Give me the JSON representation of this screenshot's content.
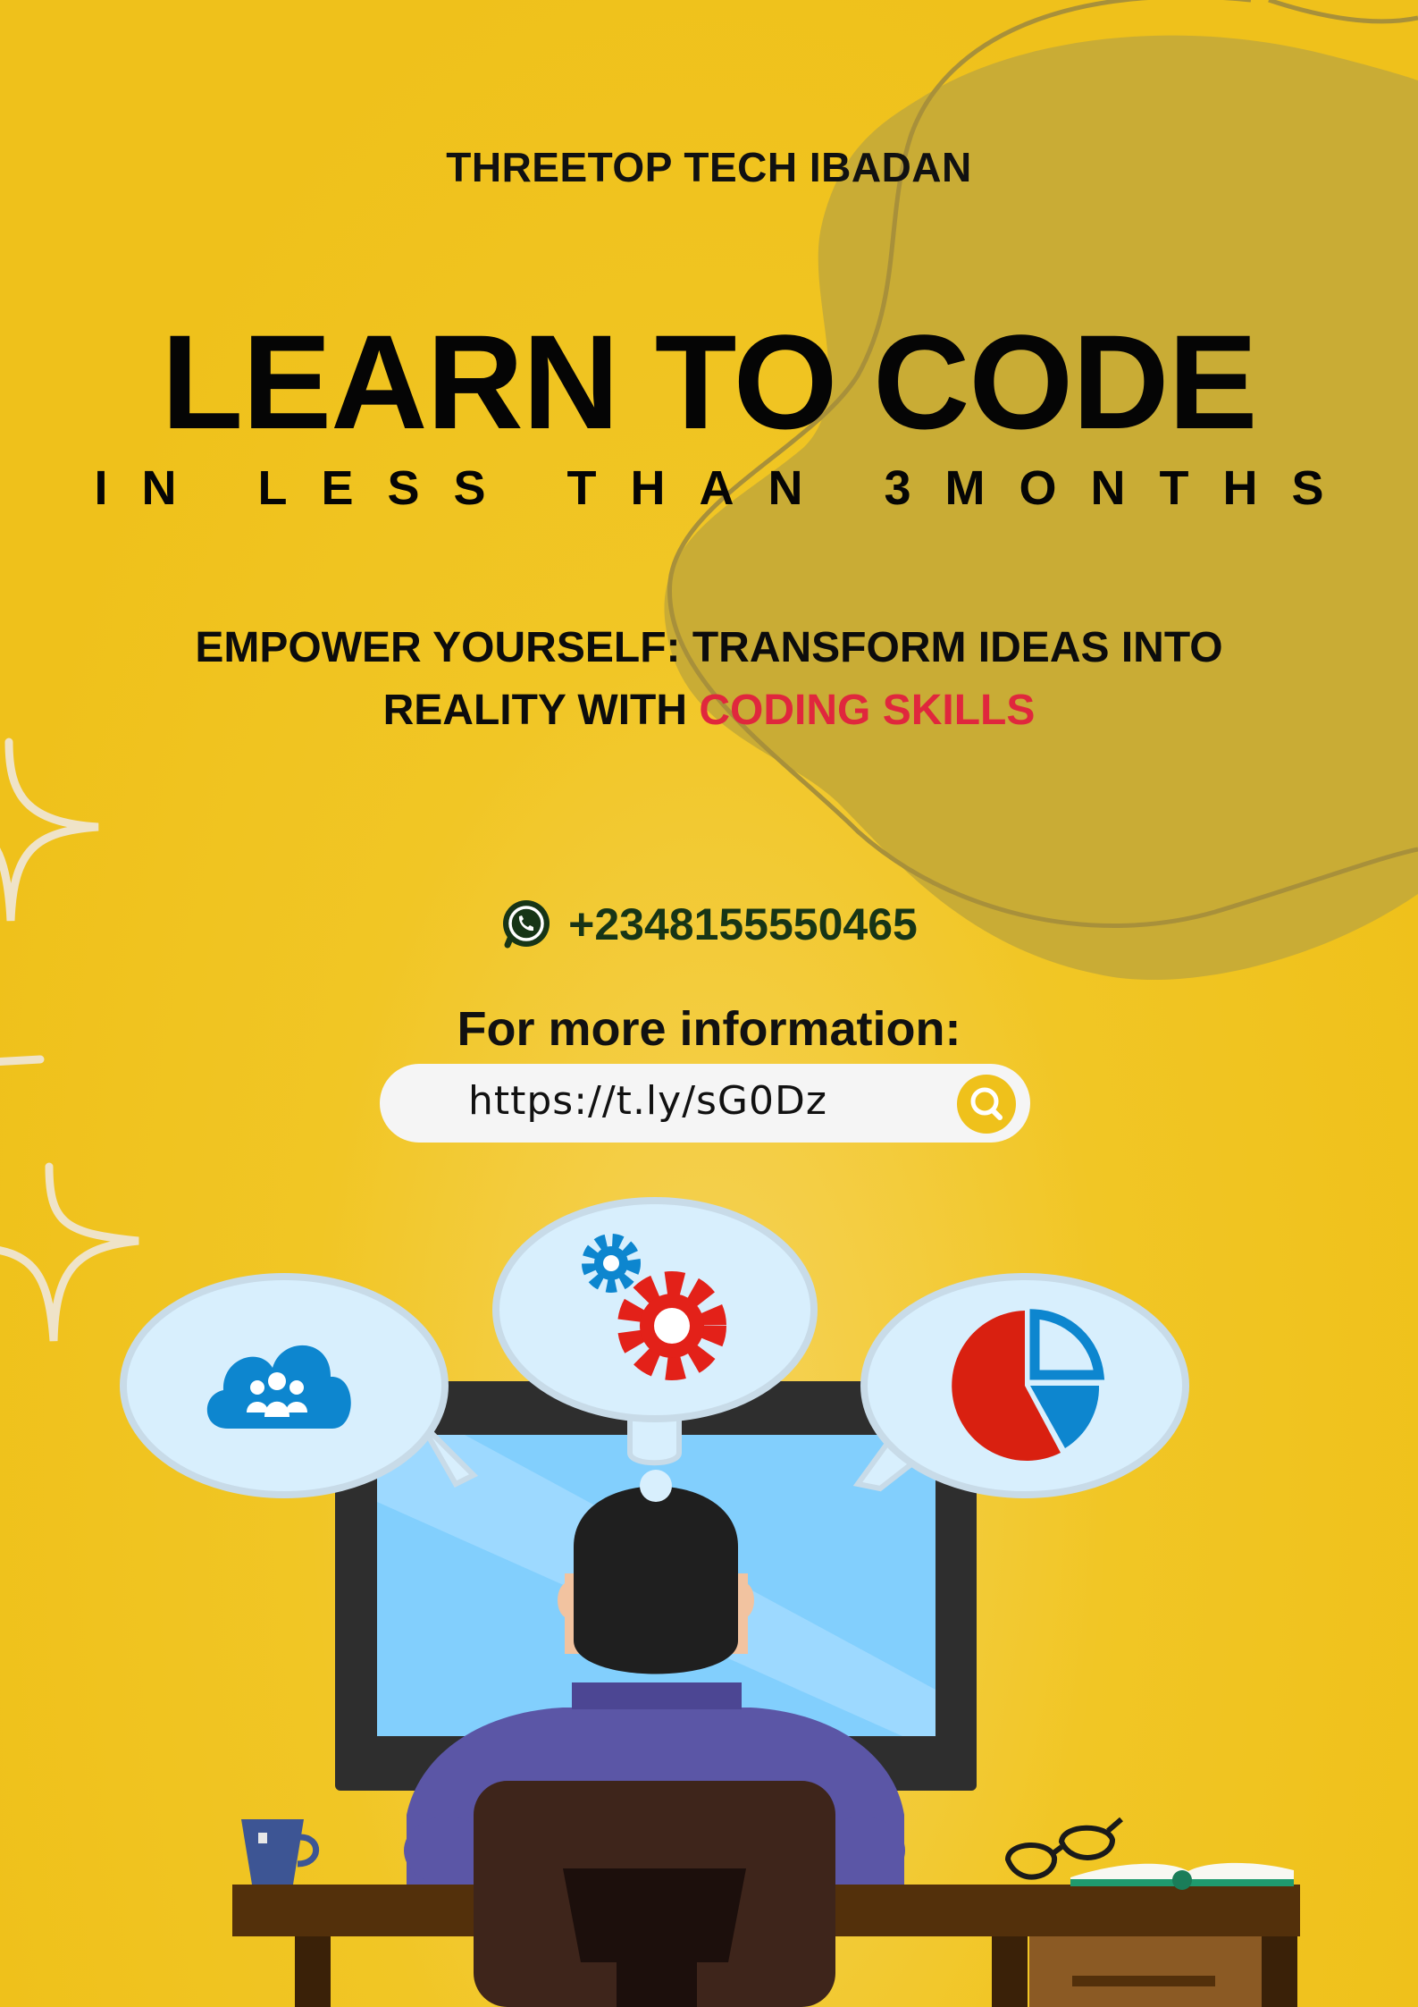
{
  "poster": {
    "organization": "THREETOP TECH IBADAN",
    "headline": "LEARN TO CODE",
    "subheadline": "IN LESS THAN 3MONTHS",
    "tagline_main": "EMPOWER YOURSELF: TRANSFORM IDEAS INTO REALITY WITH",
    "tagline_highlight": "CODING SKILLS"
  },
  "contact": {
    "phone": "+2348155550465",
    "phone_icon": "whatsapp-icon"
  },
  "info": {
    "label": "For more information:",
    "url": "https://t.ly/sG0Dz",
    "search_icon": "search-icon"
  },
  "colors": {
    "background": "#efc11b",
    "blob": "#c9ac35",
    "highlight": "#e0273d",
    "phone_text": "#173516"
  },
  "illustration": {
    "bubbles": [
      "cloud-users-icon",
      "gears-icon",
      "pie-chart-icon"
    ]
  }
}
